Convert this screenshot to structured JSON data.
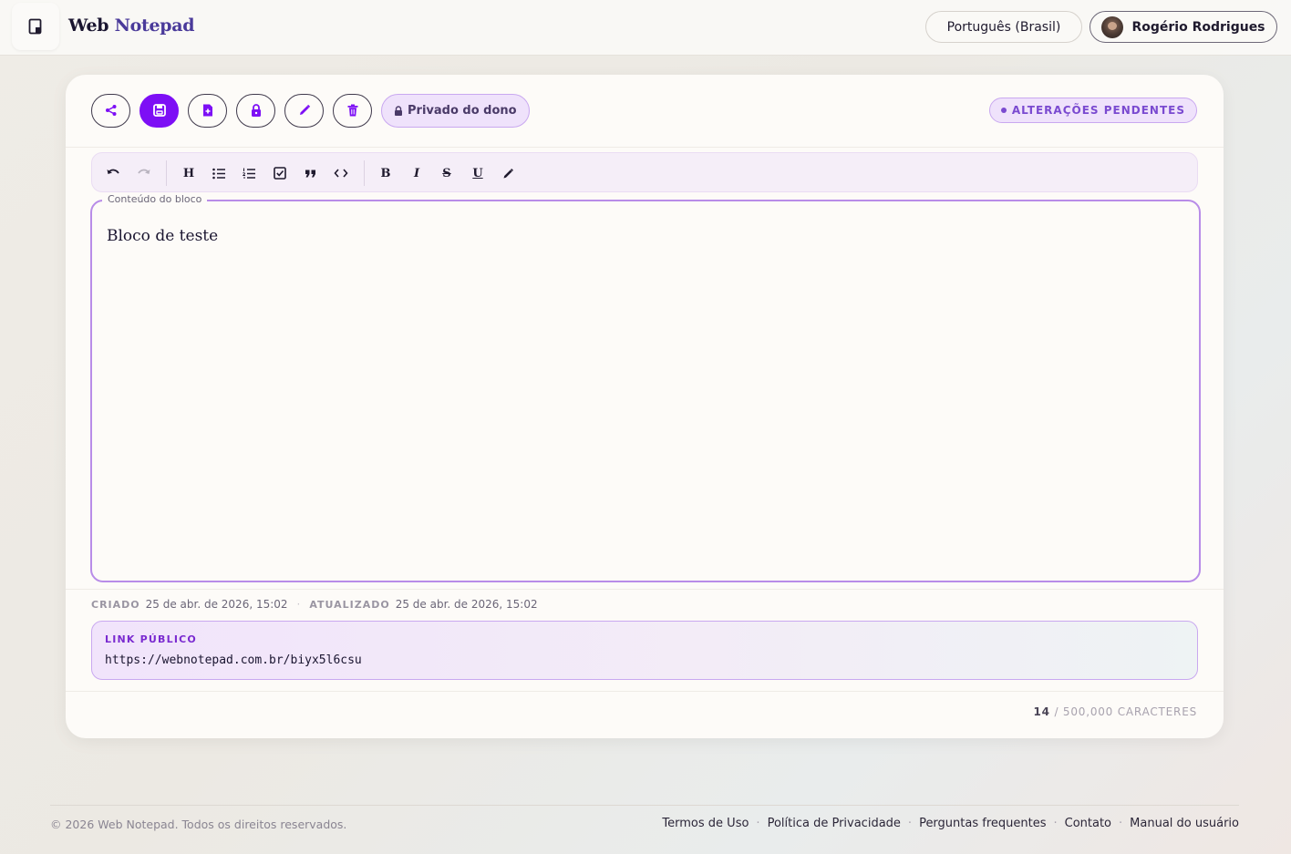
{
  "header": {
    "brand_part1": "Web",
    "brand_part2": "Notepad",
    "language": "Português (Brasil)",
    "user_name": "Rogério Rodrigues"
  },
  "actions": {
    "privacy_label": "Privado do dono",
    "status_label": "ALTERAÇÕES PENDENTES"
  },
  "toolbar": {
    "heading": "H",
    "bold": "B",
    "italic": "I",
    "strike": "S",
    "underline": "U"
  },
  "editor": {
    "legend": "Conteúdo do bloco",
    "content": "Bloco de teste"
  },
  "meta": {
    "created_label": "CRIADO",
    "created_value": "25 de abr. de 2026, 15:02",
    "updated_label": "ATUALIZADO",
    "updated_value": "25 de abr. de 2026, 15:02"
  },
  "public_link": {
    "label": "LINK PÚBLICO",
    "url": "https://webnotepad.com.br/biyx5l6csu"
  },
  "counter": {
    "count": "14",
    "limit": "/ 500,000 CARACTERES"
  },
  "footer": {
    "copyright": "© 2026 Web Notepad. Todos os direitos reservados.",
    "links": [
      "Termos de Uso",
      "Política de Privacidade",
      "Perguntas frequentes",
      "Contato",
      "Manual do usuário"
    ]
  },
  "colors": {
    "accent": "#7d0ff5",
    "accent_soft": "#efe2fb",
    "editor_border": "#b88ce8"
  }
}
